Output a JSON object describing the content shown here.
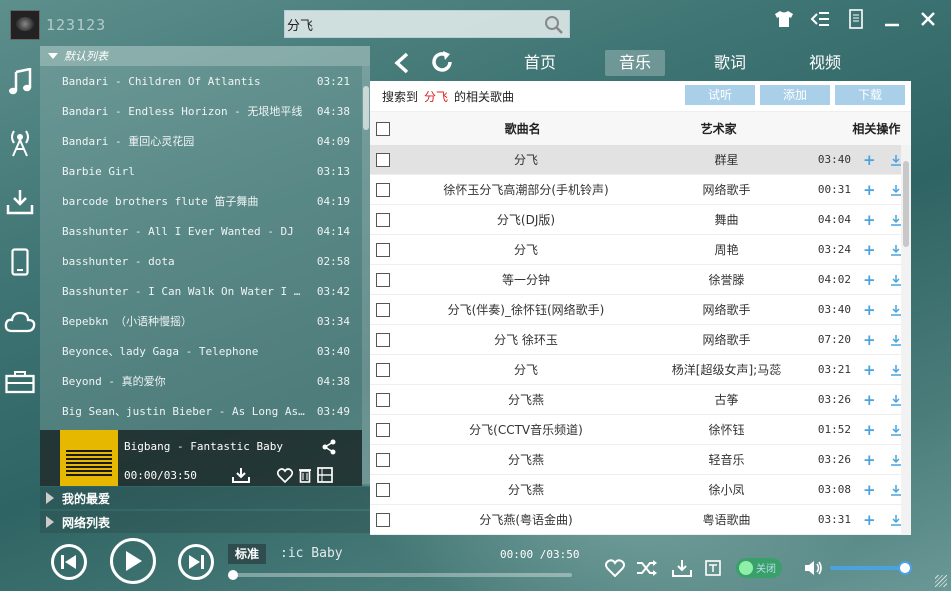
{
  "app": {
    "user_name": "123123"
  },
  "search": {
    "value": "分飞",
    "placeholder": ""
  },
  "window_buttons": [
    "skin-icon",
    "mini-mode-icon",
    "mobile-icon",
    "minimize-icon",
    "close-icon"
  ],
  "sidebar_icons": [
    "music-note-icon",
    "radio-icon",
    "download-icon",
    "phone-icon",
    "cloud-icon",
    "toolbox-icon"
  ],
  "playlist": {
    "header": "默认列表",
    "items": [
      {
        "title": "Bandari - Children Of Atlantis",
        "duration": "03:21"
      },
      {
        "title": "Bandari - Endless Horizon - 无垠地平线",
        "duration": "04:38"
      },
      {
        "title": "Bandari - 重回心灵花园",
        "duration": "04:09"
      },
      {
        "title": "Barbie Girl",
        "duration": "03:13"
      },
      {
        "title": "barcode brothers flute 笛子舞曲",
        "duration": "04:19"
      },
      {
        "title": "Basshunter - All I Ever Wanted - DJ",
        "duration": "04:14"
      },
      {
        "title": "basshunter - dota",
        "duration": "02:58"
      },
      {
        "title": "Basshunter - I Can Walk On Water I Can…",
        "duration": "03:42"
      },
      {
        "title": "Bepebkn （小语种慢摇）",
        "duration": "03:34"
      },
      {
        "title": "Beyonce、lady Gaga - Telephone",
        "duration": "03:40"
      },
      {
        "title": "Beyond - 真的爱你",
        "duration": "04:38"
      },
      {
        "title": "Big Sean、justin Bieber - As Long As Y…",
        "duration": "03:49"
      }
    ],
    "now_playing": {
      "title": "Bigbang - Fantastic Baby",
      "time": "00:00/03:50"
    },
    "groups": [
      "我的最爱",
      "网络列表"
    ]
  },
  "nav": {
    "tabs": [
      {
        "label": "首页",
        "active": false
      },
      {
        "label": "音乐",
        "active": true
      },
      {
        "label": "歌词",
        "active": false
      },
      {
        "label": "视频",
        "active": false
      }
    ]
  },
  "results": {
    "prefix": "搜索到",
    "keyword": "分飞",
    "suffix": "的相关歌曲",
    "actions": [
      "试听",
      "添加",
      "下载"
    ],
    "columns": {
      "song": "歌曲名",
      "artist": "艺术家",
      "ops": "相关操作"
    },
    "rows": [
      {
        "song": "分飞",
        "artist": "群星",
        "duration": "03:40",
        "selected": true
      },
      {
        "song": "徐怀玉分飞高潮部分(手机铃声)",
        "artist": "网络歌手",
        "duration": "00:31"
      },
      {
        "song": "分飞(DJ版)",
        "artist": "舞曲",
        "duration": "04:04"
      },
      {
        "song": "分飞",
        "artist": "周艳",
        "duration": "03:24"
      },
      {
        "song": "等一分钟",
        "artist": "徐誉滕",
        "duration": "04:02"
      },
      {
        "song": "分飞(伴奏)_徐怀钰(网络歌手)",
        "artist": "网络歌手",
        "duration": "03:40"
      },
      {
        "song": "分飞 徐环玉",
        "artist": "网络歌手",
        "duration": "07:20"
      },
      {
        "song": "分飞",
        "artist": "杨洋[超级女声];马蕊",
        "duration": "03:21"
      },
      {
        "song": "分飞燕",
        "artist": "古筝",
        "duration": "03:26"
      },
      {
        "song": "分飞(CCTV音乐频道)",
        "artist": "徐怀钰",
        "duration": "01:52"
      },
      {
        "song": "分飞燕",
        "artist": "轻音乐",
        "duration": "03:26"
      },
      {
        "song": "分飞燕",
        "artist": "徐小凤",
        "duration": "03:08"
      },
      {
        "song": "分飞燕(粤语金曲)",
        "artist": "粤语歌曲",
        "duration": "03:31"
      }
    ]
  },
  "player": {
    "quality": "标准",
    "marquee": ":ic Baby",
    "time": "00:00 /03:50",
    "progress": 0,
    "volume": 0.95,
    "lyric_toggle_label": "关闭"
  },
  "colors": {
    "accent": "#4aa3df",
    "keyword": "#dd2222",
    "action_button": "#a9d0e8"
  }
}
